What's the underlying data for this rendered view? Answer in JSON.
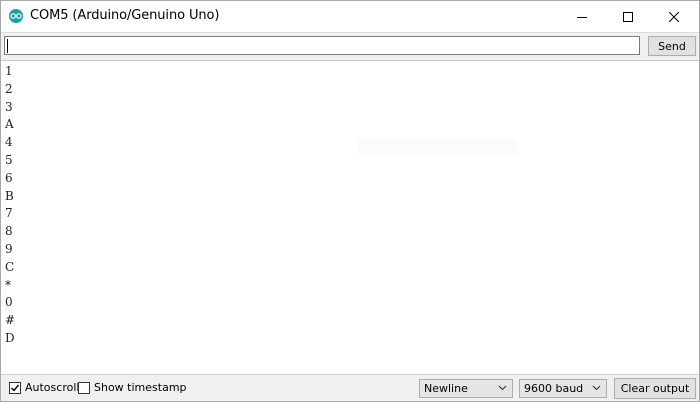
{
  "window": {
    "title": "COM5 (Arduino/Genuino Uno)"
  },
  "input": {
    "value": "",
    "send_label": "Send"
  },
  "output": {
    "lines": [
      "1",
      "2",
      "3",
      "A",
      "4",
      "5",
      "6",
      "B",
      "7",
      "8",
      "9",
      "C",
      "*",
      "0",
      "#",
      "D"
    ]
  },
  "status": {
    "autoscroll": {
      "label": "Autoscroll",
      "checked": true
    },
    "timestamp": {
      "label": "Show timestamp",
      "checked": false
    },
    "line_ending": "Newline",
    "baud": "9600 baud",
    "clear_label": "Clear output"
  },
  "colors": {
    "accent": "#17a1a5",
    "chrome": "#f0f0f0"
  },
  "icons": [
    "arduino-icon",
    "minimize-icon",
    "maximize-icon",
    "close-icon",
    "check-icon",
    "chevron-down-icon"
  ]
}
